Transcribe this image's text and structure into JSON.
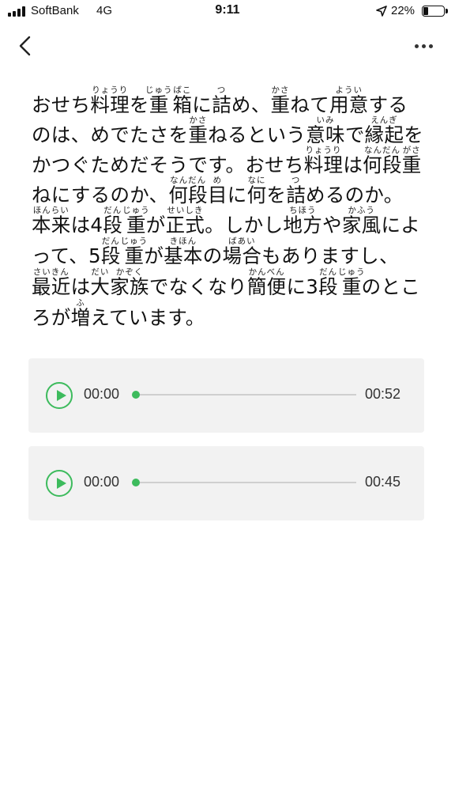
{
  "status_bar": {
    "carrier": "SoftBank",
    "network": "4G",
    "time": "9:11",
    "battery_percent": "22%",
    "battery_level": 0.22,
    "icons": [
      "signal-icon",
      "location-arrow-icon",
      "battery-icon"
    ]
  },
  "nav": {
    "back_icon": "chevron-left-icon",
    "more_icon": "more-horizontal-icon"
  },
  "article": {
    "segments": [
      {
        "t": "おせち"
      },
      {
        "t": "料理",
        "r": "りょうり"
      },
      {
        "t": "を"
      },
      {
        "t": "重",
        "r": "じゅう"
      },
      {
        "t": "箱",
        "r": "ばこ"
      },
      {
        "t": "に"
      },
      {
        "t": "詰",
        "r": "つ"
      },
      {
        "t": "め、"
      },
      {
        "t": "重",
        "r": "かさ"
      },
      {
        "t": "ねて"
      },
      {
        "t": "用意",
        "r": "ようい"
      },
      {
        "t": "するのは、めでたさを"
      },
      {
        "t": "重",
        "r": "かさ"
      },
      {
        "t": "ねるという"
      },
      {
        "t": "意味",
        "r": "いみ"
      },
      {
        "t": "で"
      },
      {
        "t": "縁起",
        "r": "えんぎ"
      },
      {
        "t": "をかつぐためだそうです。おせち"
      },
      {
        "t": "料理",
        "r": "りょうり"
      },
      {
        "t": "は"
      },
      {
        "t": "何段",
        "r": "なんだん"
      },
      {
        "t": "重",
        "r": "がさ"
      },
      {
        "t": "ねにするのか、"
      },
      {
        "t": "何段",
        "r": "なんだん"
      },
      {
        "t": "目",
        "r": "め"
      },
      {
        "t": "に"
      },
      {
        "t": "何",
        "r": "なに"
      },
      {
        "t": "を"
      },
      {
        "t": "詰",
        "r": "つ"
      },
      {
        "t": "めるのか。"
      },
      {
        "t": "本来",
        "r": "ほんらい"
      },
      {
        "t": "は4"
      },
      {
        "t": "段",
        "r": "だん"
      },
      {
        "t": "重",
        "r": "じゅう"
      },
      {
        "t": "が"
      },
      {
        "t": "正式",
        "r": "せいしき"
      },
      {
        "t": "。しかし"
      },
      {
        "t": "地方",
        "r": "ちほう"
      },
      {
        "t": "や"
      },
      {
        "t": "家風",
        "r": "かふう"
      },
      {
        "t": "によって、5"
      },
      {
        "t": "段",
        "r": "だん"
      },
      {
        "t": "重",
        "r": "じゅう"
      },
      {
        "t": "が"
      },
      {
        "t": "基本",
        "r": "きほん"
      },
      {
        "t": "の"
      },
      {
        "t": "場合",
        "r": "ばあい"
      },
      {
        "t": "もありますし、"
      },
      {
        "t": "最近",
        "r": "さいきん"
      },
      {
        "t": "は"
      },
      {
        "t": "大",
        "r": "だい"
      },
      {
        "t": "家族",
        "r": "かぞく"
      },
      {
        "t": "でなくなり"
      },
      {
        "t": "簡便",
        "r": "かんべん"
      },
      {
        "t": "に3"
      },
      {
        "t": "段",
        "r": "だん"
      },
      {
        "t": "重",
        "r": "じゅう"
      },
      {
        "t": "のところが"
      },
      {
        "t": "増",
        "r": "ふ"
      },
      {
        "t": "えています。"
      }
    ]
  },
  "players": [
    {
      "current": "00:00",
      "duration": "00:52",
      "progress": 0,
      "play_icon": "play-icon"
    },
    {
      "current": "00:00",
      "duration": "00:45",
      "progress": 0,
      "play_icon": "play-icon"
    }
  ],
  "colors": {
    "accent": "#3dbb5d",
    "player_background": "#f2f2f2",
    "text": "#111111"
  }
}
